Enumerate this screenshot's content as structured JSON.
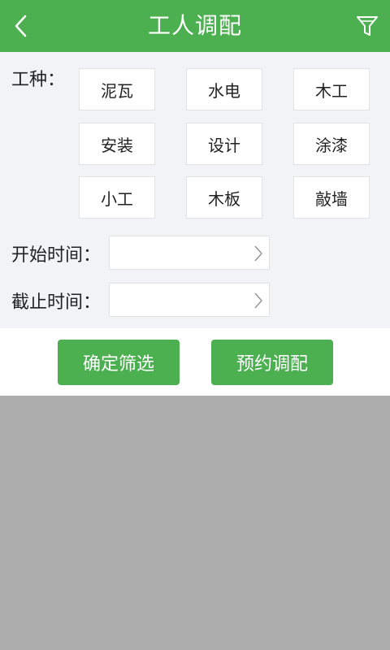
{
  "header": {
    "title": "工人调配",
    "back_icon": "chevron-left-icon",
    "filter_icon": "filter-funnel-icon",
    "color": "#4caf50"
  },
  "filter": {
    "type_label": "工种：",
    "types": [
      "泥瓦",
      "水电",
      "木工",
      "安装",
      "设计",
      "涂漆",
      "小工",
      "木板",
      "敲墙"
    ],
    "start_label": "开始时间：",
    "start_value": "",
    "end_label": "截止时间：",
    "end_value": ""
  },
  "actions": {
    "confirm_label": "确定筛选",
    "book_label": "预约调配"
  },
  "overlay_color": "#adadad"
}
